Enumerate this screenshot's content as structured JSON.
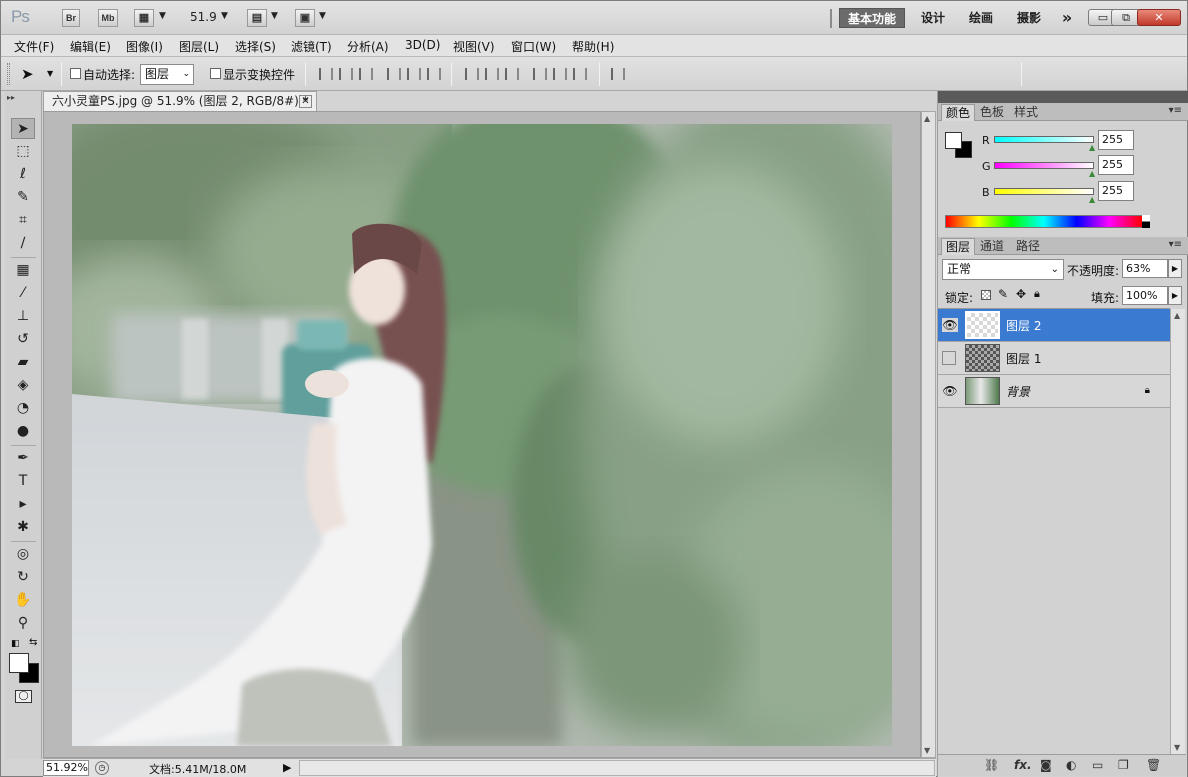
{
  "app": {
    "logo": "Ps",
    "bridge": "Br",
    "minibridge": "Mb",
    "zoom_display": "51.9",
    "workspaces": [
      "基本功能",
      "设计",
      "绘画",
      "摄影"
    ],
    "more": "»",
    "window_buttons": {
      "minimize": "▭",
      "restore": "⧉",
      "close": "✕"
    }
  },
  "menu": [
    "文件(F)",
    "编辑(E)",
    "图像(I)",
    "图层(L)",
    "选择(S)",
    "滤镜(T)",
    "分析(A)",
    "3D(D)",
    "视图(V)",
    "窗口(W)",
    "帮助(H)"
  ],
  "options": {
    "auto_select_label": "自动选择:",
    "auto_select_value": "图层",
    "show_transform_label": "显示变换控件"
  },
  "document": {
    "tab_title": "六小灵童PS.jpg @ 51.9% (图层 2, RGB/8#) *",
    "close": "✕"
  },
  "status": {
    "zoom": "51.92%",
    "doc_info": "文档:5.41M/18.0M"
  },
  "color_panel": {
    "tabs": [
      "颜色",
      "色板",
      "样式"
    ],
    "r_label": "R",
    "g_label": "G",
    "b_label": "B",
    "r": "255",
    "g": "255",
    "b": "255",
    "fg_color": "#ffffff",
    "bg_color": "#000000"
  },
  "layers_panel": {
    "tabs": [
      "图层",
      "通道",
      "路径"
    ],
    "blend_mode": "正常",
    "opacity_label": "不透明度:",
    "opacity": "63%",
    "lock_label": "锁定:",
    "fill_label": "填充:",
    "fill": "100%",
    "layers": [
      {
        "name": "图层 2",
        "visible": true,
        "selected": true
      },
      {
        "name": "图层 1",
        "visible": false,
        "selected": false
      },
      {
        "name": "背景",
        "visible": true,
        "selected": false,
        "locked": true
      }
    ],
    "footer_icons": [
      "link-icon",
      "fx-icon",
      "mask-icon",
      "adjustment-icon",
      "group-icon",
      "new-layer-icon",
      "trash-icon"
    ]
  },
  "colors": {
    "selection": "#3a7ad0",
    "workspace_active": "#6b6b6b"
  }
}
